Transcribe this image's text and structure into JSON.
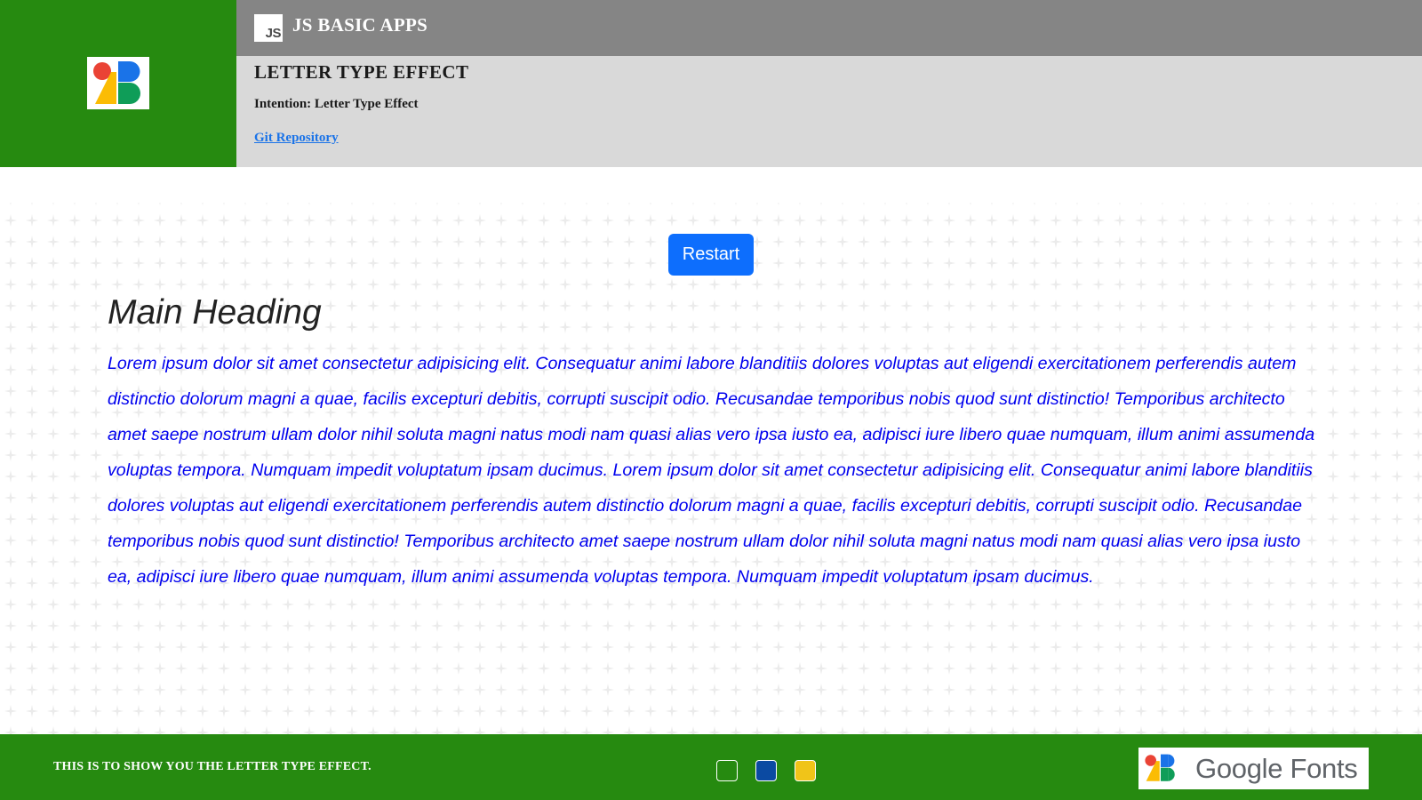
{
  "header": {
    "app_title": "JS BASIC APPS",
    "js_badge": "JS",
    "logo_icon": "google-fonts-logo-icon",
    "page_title": "LETTER TYPE EFFECT",
    "intention": "Intention: Letter Type Effect",
    "git_link": "Git Repository"
  },
  "main": {
    "restart_label": "Restart",
    "heading": "Main Heading",
    "paragraph": "Lorem ipsum dolor sit amet consectetur adipisicing elit. Consequatur animi labore blanditiis dolores voluptas aut eligendi exercitationem perferendis autem distinctio dolorum magni a quae, facilis excepturi debitis, corrupti suscipit odio. Recusandae temporibus nobis quod sunt distinctio! Temporibus architecto amet saepe nostrum ullam dolor nihil soluta magni natus modi nam quasi alias vero ipsa iusto ea, adipisci iure libero quae numquam, illum animi assumenda voluptas tempora. Numquam impedit voluptatum ipsam ducimus. Lorem ipsum dolor sit amet consectetur adipisicing elit. Consequatur animi labore blanditiis dolores voluptas aut eligendi exercitationem perferendis autem distinctio dolorum magni a quae, facilis excepturi debitis, corrupti suscipit odio. Recusandae temporibus nobis quod sunt distinctio! Temporibus architecto amet saepe nostrum ullam dolor nihil soluta magni natus modi nam quasi alias vero ipsa iusto ea, adipisci iure libero quae numquam, illum animi assumenda voluptas tempora. Numquam impedit voluptatum ipsam ducimus."
  },
  "footer": {
    "text": "THIS IS TO SHOW YOU THE LETTER TYPE EFFECT.",
    "swatches": [
      "#268a10",
      "#0b4aa2",
      "#f0c419"
    ],
    "brand": "Google Fonts"
  },
  "colors": {
    "green": "#268a10",
    "topbar_gray": "#858585",
    "infobar_gray": "#d9d9d9",
    "button_blue": "#0d6efd",
    "paragraph_blue": "#0000ee"
  }
}
